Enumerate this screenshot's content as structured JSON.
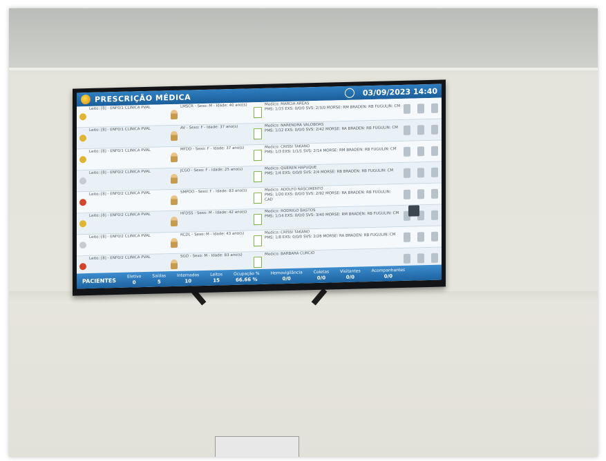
{
  "display": {
    "title": "PRESCRIÇÃO MÉDICA",
    "date_time": "03/09/2023 14:40",
    "footer_label": "PACIENTES",
    "footer_stats": [
      {
        "label": "Eletivo",
        "value": "0"
      },
      {
        "label": "Saídas",
        "value": "5"
      },
      {
        "label": "Internados",
        "value": "10"
      },
      {
        "label": "Leitos",
        "value": "15"
      },
      {
        "label": "Ocupação %",
        "value": "66.66 %"
      },
      {
        "label": "Hemovigilância",
        "value": "0/0"
      },
      {
        "label": "Coletas",
        "value": "0/0"
      },
      {
        "label": "Visitantes",
        "value": "0/0"
      },
      {
        "label": "Acompanhantes",
        "value": "0/0"
      }
    ],
    "rows": [
      {
        "dot": "#e0b531",
        "bed": "Leito: [8] - ENF0/1 CLÍNICA PVAL",
        "patient": "LMSCR - Sexo: M - Idade: 40 ano(s)",
        "doctor": "Medico: MARCIA AREAS",
        "notes": "PMS: 1/15 EXS: 0/0/0 SVS: 2/3/0 MORSE: RM BRADEN: RB FUGULIN: CM"
      },
      {
        "dot": "#e0b531",
        "bed": "Leito: [8] - ENF0/1 CLÍNICA PVAL",
        "patient": "AV - Sexo: F - Idade: 37 ano(s)",
        "doctor": "Medico: NARENDRA VALOBOAS",
        "notes": "PMS: 1/12 EXS: 0/0/0 SVS: 2/42 MORSE: RA BRADEN: RB FUGULIN: CM"
      },
      {
        "dot": "#e0b531",
        "bed": "Leito: [8] - ENF0/1 CLÍNICA PVAL",
        "patient": "MFDD - Sexo: F - Idade: 37 ano(s)",
        "doctor": "Medico: CRISSI TAKANO",
        "notes": "PMS: 1/3 EXS: 1/1/1 SVS: 2/14 MORSE: RM BRADEN: RB FUGULIN: CM"
      },
      {
        "dot": "#c8ccd0",
        "bed": "Leito: [8] - ENF0/2 CLÍNICA PVAL",
        "patient": "JCGO - Sexo: F - Idade: 25 ano(s)",
        "doctor": "Medico: QUEREN HAPUQUE",
        "notes": "PMS: 1/4 EXS: 0/0/0 SVS: 2/4 MORSE: RB BRADEN: RB FUGULIN: CM"
      },
      {
        "dot": "#d2452b",
        "bed": "Leito: [8] - ENF0/2 CLÍNICA PVAL",
        "patient": "SMPOO - Sexo: F - Idade: 83 ano(s)",
        "doctor": "Medico: ADOLFO NASCIMENTO",
        "notes": "PMS: 1/20 EXS: 0/0/0 SVS: 2/92 MORSE: RA BRADEN: RB FUGULIN: CAD"
      },
      {
        "dot": "#e0b531",
        "bed": "Leito: [8] - ENF0/2 CLÍNICA PVAL",
        "patient": "HFDSS - Sexo: M - Idade: 42 ano(s)",
        "doctor": "Medico: RODRIGO BASTOS",
        "notes": "PMS: 1/14 EXS: 0/0/0 SVS: 3/40 MORSE: RM BRADEN: RB FUGULIN: CM"
      },
      {
        "dot": "#c8ccd0",
        "bed": "Leito: [8] - ENF0/2 CLÍNICA PVAL",
        "patient": "RCDL - Sexo: M - Idade: 43 ano(s)",
        "doctor": "Medico: CRISSI TAKANO",
        "notes": "PMS: 1/8 EXS: 0/0/0 SVS: 2/26 MORSE: RA BRADEN: RB FUGULIN: CM"
      },
      {
        "dot": "#d2452b",
        "bed": "Leito: [8] - ENF0/2 CLÍNICA PVAL",
        "patient": "SGO - Sexo: M - Idade: 83 ano(s)",
        "doctor": "Medico: BARBARA CURCIO",
        "notes": ""
      }
    ]
  }
}
